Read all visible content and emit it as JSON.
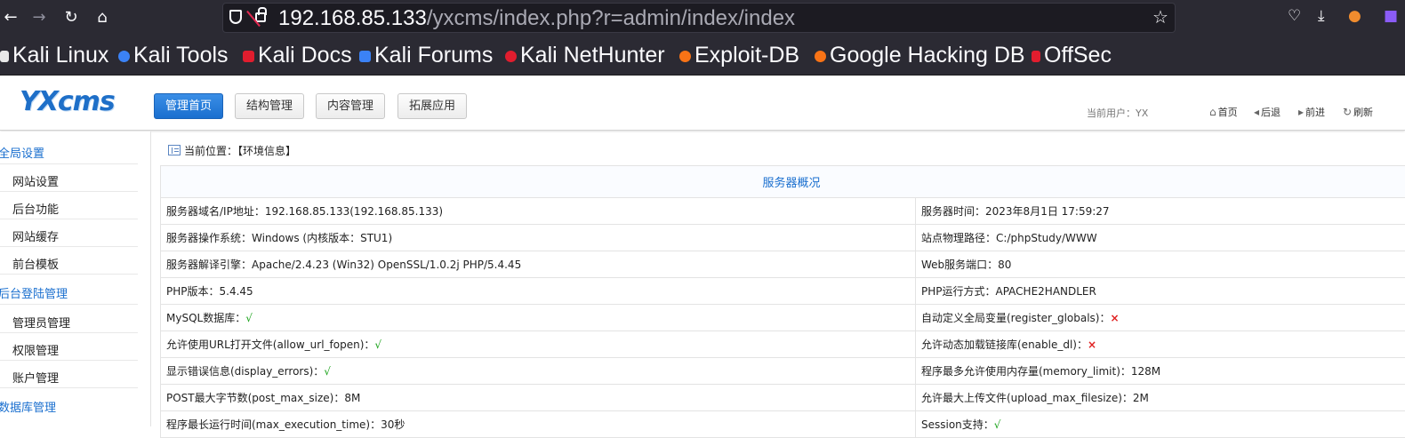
{
  "browser": {
    "url_host": "192.168.85.133",
    "url_path": "/yxcms/index.php?r=admin/index/index",
    "bookmarks": [
      {
        "label": "Kali Linux",
        "color": "#e8e8e8"
      },
      {
        "label": "Kali Tools",
        "color": "#3b82f6"
      },
      {
        "label": "Kali Docs",
        "color": "#e11d2e"
      },
      {
        "label": "Kali Forums",
        "color": "#3b82f6"
      },
      {
        "label": "Kali NetHunter",
        "color": "#e11d2e"
      },
      {
        "label": "Exploit-DB",
        "color": "#f97316"
      },
      {
        "label": "Google Hacking DB",
        "color": "#f97316"
      },
      {
        "label": "OffSec",
        "color": "#e11d2e"
      }
    ]
  },
  "header": {
    "logo": "YXcms",
    "menu": [
      "管理首页",
      "结构管理",
      "内容管理",
      "拓展应用"
    ],
    "current_user": "当前用户：YX",
    "nav": [
      "首页",
      "后退",
      "前进",
      "刷新"
    ]
  },
  "sidebar": {
    "groups": [
      {
        "title": "全局设置",
        "items": [
          "网站设置",
          "后台功能",
          "网站缓存",
          "前台模板"
        ]
      },
      {
        "title": "后台登陆管理",
        "items": [
          "管理员管理",
          "权限管理",
          "账户管理"
        ]
      },
      {
        "title": "数据库管理",
        "items": []
      }
    ]
  },
  "main": {
    "breadcrumb": "当前位置：【环境信息】",
    "table_title": "服务器概况",
    "rows": [
      {
        "l_label": "服务器域名/IP地址：",
        "l_value": "192.168.85.133(192.168.85.133)",
        "r_label": "服务器时间：",
        "r_value": "2023年8月1日 17:59:27"
      },
      {
        "l_label": "服务器操作系统：",
        "l_value": "Windows (内核版本：STU1)",
        "r_label": "站点物理路径：",
        "r_value": "C:/phpStudy/WWW"
      },
      {
        "l_label": "服务器解译引擎：",
        "l_value": "Apache/2.4.23 (Win32) OpenSSL/1.0.2j PHP/5.4.45",
        "r_label": "Web服务端口：",
        "r_value": "80"
      },
      {
        "l_label": "PHP版本：",
        "l_value": "5.4.45",
        "r_label": "PHP运行方式：",
        "r_value": "APACHE2HANDLER"
      },
      {
        "l_label": "MySQL数据库：",
        "l_value": "√",
        "l_status": "ok",
        "r_label": "自动定义全局变量(register_globals)：",
        "r_value": "×",
        "r_status": "no"
      },
      {
        "l_label": "允许使用URL打开文件(allow_url_fopen)：",
        "l_value": "√",
        "l_status": "ok",
        "r_label": "允许动态加载链接库(enable_dl)：",
        "r_value": "×",
        "r_status": "no"
      },
      {
        "l_label": "显示错误信息(display_errors)：",
        "l_value": "√",
        "l_status": "ok",
        "r_label": "程序最多允许使用内存量(memory_limit)：",
        "r_value": "128M"
      },
      {
        "l_label": "POST最大字节数(post_max_size)：",
        "l_value": "8M",
        "r_label": "允许最大上传文件(upload_max_filesize)：",
        "r_value": "2M"
      },
      {
        "l_label": "程序最长运行时间(max_execution_time)：",
        "l_value": "30秒",
        "r_label": "Session支持：",
        "r_value": "√",
        "r_status": "ok"
      }
    ]
  }
}
